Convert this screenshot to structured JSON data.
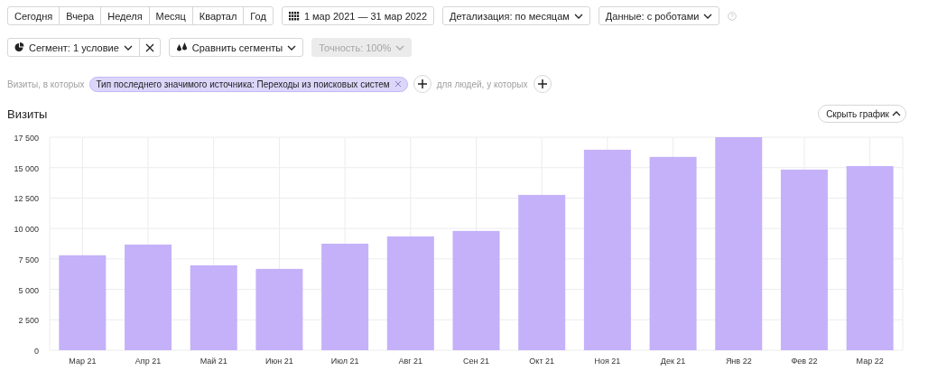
{
  "period_buttons": [
    "Сегодня",
    "Вчера",
    "Неделя",
    "Месяц",
    "Квартал",
    "Год"
  ],
  "date_range": "1 мар 2021 — 31 мар 2022",
  "detail_dropdown": "Детализация: по месяцам",
  "data_dropdown": "Данные: с роботами",
  "segment_dropdown": "Сегмент: 1 условие",
  "compare_button": "Сравнить сегменты",
  "accuracy_dropdown": {
    "label": "Точность: 100%",
    "disabled": true
  },
  "filter": {
    "prefix": "Визиты, в которых",
    "condition": "Тип последнего значимого источника: Переходы из поисковых систем",
    "people_label": "для людей, у которых"
  },
  "title": "Визиты",
  "hide_chart_button": "Скрыть график",
  "chart_data": {
    "type": "bar",
    "categories": [
      "Мар 21",
      "Апр 21",
      "Май 21",
      "Июн 21",
      "Июл 21",
      "Авг 21",
      "Сен 21",
      "Окт 21",
      "Ноя 21",
      "Дек 21",
      "Янв 22",
      "Фев 22",
      "Мар 22"
    ],
    "grid": true,
    "series": [
      {
        "color": "#c4b1f9",
        "values": [
          7800,
          8680,
          6970,
          6680,
          8750,
          9350,
          9800,
          12760,
          16470,
          15880,
          17500,
          14840,
          15130
        ]
      }
    ],
    "ylim": [
      0,
      17500
    ],
    "yticks": [
      {
        "value": 0,
        "label": "0"
      },
      {
        "value": 2500,
        "label": "2 500"
      },
      {
        "value": 5000,
        "label": "5 000"
      },
      {
        "value": 7500,
        "label": "7 500"
      },
      {
        "value": 10000,
        "label": "10 000"
      },
      {
        "value": 12500,
        "label": "12 500"
      },
      {
        "value": 15000,
        "label": "15 000"
      },
      {
        "value": 17500,
        "label": "17 500"
      }
    ]
  }
}
